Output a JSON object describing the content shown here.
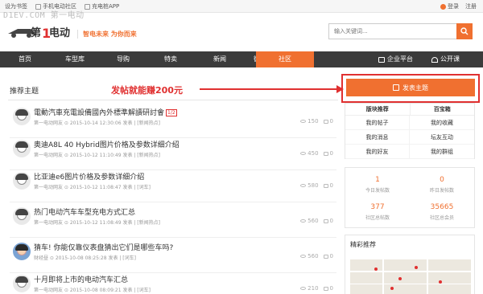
{
  "topbar": {
    "left_links": [
      "设为书签",
      "手机电动社区",
      "充电桩APP"
    ],
    "login": "登录",
    "register": "注册"
  },
  "watermark": "D1EV.COM 第一电动",
  "header": {
    "logo_alt": "第1电动",
    "slogan": "智电未来 为你而来",
    "search_placeholder": "输入关键词..."
  },
  "nav": {
    "items": [
      "首页",
      "车型库",
      "导购",
      "特卖",
      "新闻",
      "微电之家",
      "社区"
    ],
    "active_index": 6,
    "right_items": [
      "企业平台",
      "公开课"
    ]
  },
  "main": {
    "section_title": "推荐主题",
    "promo_text": "发帖就能赚200元",
    "posts": [
      {
        "title": "電動汽車充電設備國內外標準解讀研討會",
        "badge": "1/2",
        "meta": "第一电动网友  ⊙ 2015-10-14 12:30:06 发表 | [新闻热点]",
        "views": "150",
        "comments": "0"
      },
      {
        "title": "奥迪A8L 40 Hybrid图片价格及参数详细介绍",
        "badge": "",
        "meta": "第一电动网友  ⊙ 2015-10-12 11:10:49 发表 | [新闻热点]",
        "views": "450",
        "comments": "0"
      },
      {
        "title": "比亚迪e6图片价格及参数详细介绍",
        "badge": "",
        "meta": "第一电动网友  ⊙ 2015-10-12 11:08:47 发表 | [词车]",
        "views": "580",
        "comments": "0"
      },
      {
        "title": "热门电动汽车车型充电方式汇总",
        "badge": "",
        "meta": "第一电动网友  ⊙ 2015-10-12 11:08:49 发表 | [新闻热点]",
        "views": "560",
        "comments": "0"
      },
      {
        "title": "猜车! 你能仅靠仪表盘猜出它们是哪些车吗?",
        "badge": "",
        "meta": "财经昼  ⊙ 2015-10-08 08:25:28 发表 | [词车]",
        "views": "560",
        "comments": "0"
      },
      {
        "title": "十月即将上市的电动汽车汇总",
        "badge": "",
        "meta": "第一电动网友  ⊙ 2015-10-08 08:09:21 发表 | [词车]",
        "views": "210",
        "comments": "0"
      }
    ]
  },
  "sidebar": {
    "post_button": "发表主题",
    "quick_headers": [
      "版块推荐",
      "百宝箱"
    ],
    "quick_links": [
      "我的帖子",
      "我的收藏",
      "我的消息",
      "坛友互动",
      "我的好友",
      "我的群组"
    ],
    "stats": [
      {
        "num": "1",
        "label": "今日发帖数"
      },
      {
        "num": "0",
        "label": "昨日发帖数"
      },
      {
        "num": "377",
        "label": "社区总帖数"
      },
      {
        "num": "35665",
        "label": "社区总会员"
      }
    ],
    "featured_title": "精彩推荐"
  },
  "colors": {
    "accent": "#f07030",
    "nav_bg": "#3b3b3b",
    "highlight": "#e03030"
  }
}
